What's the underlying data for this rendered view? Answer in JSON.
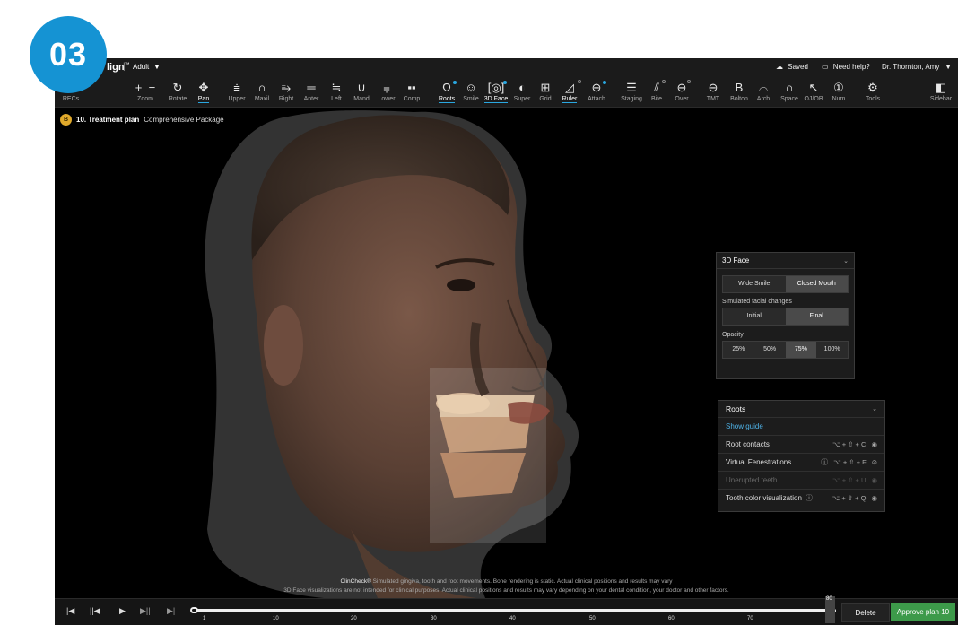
{
  "step_badge": "03",
  "topbar": {
    "brand": "lign",
    "brand_mark": "™",
    "separator": "|",
    "mode_label": "Adult",
    "saved_label": "Saved",
    "help_label": "Need help?",
    "user_label": "Dr. Thornton, Amy"
  },
  "toolbar": {
    "recs": "RECs",
    "zoom": "Zoom",
    "rotate": "Rotate",
    "pan": "Pan",
    "upper": "Upper",
    "maxil": "Maxil",
    "right": "Right",
    "anter": "Anter",
    "left": "Left",
    "mand": "Mand",
    "lower": "Lower",
    "comp": "Comp",
    "roots": "Roots",
    "smile": "Smile",
    "face3d": "3D Face",
    "super": "Super",
    "grid": "Grid",
    "ruler": "Ruler",
    "attach": "Attach",
    "staging": "Staging",
    "bite": "Bite",
    "over": "Over",
    "tmt": "TMT",
    "bolton": "Bolton",
    "arch": "Arch",
    "space": "Space",
    "ojob": "OJ/OB",
    "num": "Num",
    "tools": "Tools",
    "sidebar": "Sidebar"
  },
  "plan": {
    "icon_label": "B",
    "title": "10. Treatment plan",
    "package": "Comprehensive Package"
  },
  "face_panel": {
    "title": "3D Face",
    "smile_options": [
      "Wide Smile",
      "Closed Mouth"
    ],
    "smile_selected": "Closed Mouth",
    "changes_label": "Simulated facial changes",
    "changes_options": [
      "Initial",
      "Final"
    ],
    "changes_selected": "Final",
    "opacity_label": "Opacity",
    "opacity_options": [
      "25%",
      "50%",
      "75%",
      "100%"
    ],
    "opacity_selected": "75%"
  },
  "roots_panel": {
    "title": "Roots",
    "show_guide": "Show guide",
    "rows": [
      {
        "label": "Root contacts",
        "shortcut": "⌥ + ⇧ + C",
        "info": false,
        "disabled": false,
        "visible": true
      },
      {
        "label": "Virtual Fenestrations",
        "shortcut": "⌥ + ⇧ + F",
        "info": true,
        "disabled": false,
        "visible": false
      },
      {
        "label": "Unerupted teeth",
        "shortcut": "⌥ + ⇧ + U",
        "info": false,
        "disabled": true,
        "visible": true
      },
      {
        "label": "Tooth color visualization",
        "shortcut": "⌥ + ⇧ + Q",
        "info": true,
        "disabled": false,
        "visible": true
      }
    ]
  },
  "disclaimer": {
    "brand": "ClinCheck®",
    "line1": " Simulated gingiva, tooth and root movements. Bone rendering is static. Actual clinical positions and results may vary",
    "line2": "3D Face visualizations are not intended for clinical purposes. Actual clinical positions and results may vary depending on your dental condition, your doctor and other factors."
  },
  "timeline": {
    "ticks": [
      "1",
      "10",
      "20",
      "30",
      "40",
      "50",
      "60",
      "70"
    ],
    "current_stage": "80",
    "delete_label": "Delete",
    "approve_label": "Approve plan 10"
  },
  "colors": {
    "accent": "#2aa7e0",
    "approve": "#3d9a4a",
    "badge": "#1593d3",
    "plan_icon": "#e0a92b"
  }
}
